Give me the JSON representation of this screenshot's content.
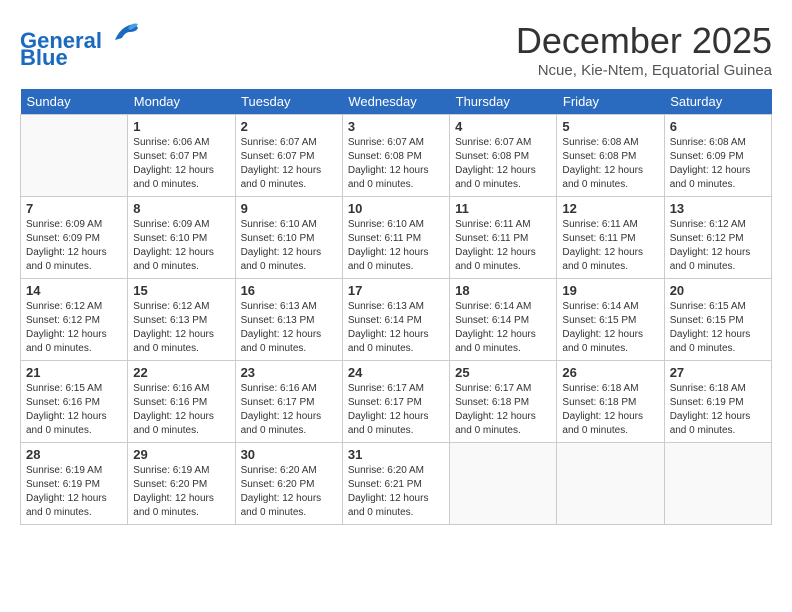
{
  "logo": {
    "line1": "General",
    "line2": "Blue"
  },
  "title": "December 2025",
  "subtitle": "Ncue, Kie-Ntem, Equatorial Guinea",
  "days_of_week": [
    "Sunday",
    "Monday",
    "Tuesday",
    "Wednesday",
    "Thursday",
    "Friday",
    "Saturday"
  ],
  "weeks": [
    [
      {
        "day": null,
        "info": null
      },
      {
        "day": "1",
        "sunrise": "Sunrise: 6:06 AM",
        "sunset": "Sunset: 6:07 PM",
        "daylight": "Daylight: 12 hours and 0 minutes."
      },
      {
        "day": "2",
        "sunrise": "Sunrise: 6:07 AM",
        "sunset": "Sunset: 6:07 PM",
        "daylight": "Daylight: 12 hours and 0 minutes."
      },
      {
        "day": "3",
        "sunrise": "Sunrise: 6:07 AM",
        "sunset": "Sunset: 6:08 PM",
        "daylight": "Daylight: 12 hours and 0 minutes."
      },
      {
        "day": "4",
        "sunrise": "Sunrise: 6:07 AM",
        "sunset": "Sunset: 6:08 PM",
        "daylight": "Daylight: 12 hours and 0 minutes."
      },
      {
        "day": "5",
        "sunrise": "Sunrise: 6:08 AM",
        "sunset": "Sunset: 6:08 PM",
        "daylight": "Daylight: 12 hours and 0 minutes."
      },
      {
        "day": "6",
        "sunrise": "Sunrise: 6:08 AM",
        "sunset": "Sunset: 6:09 PM",
        "daylight": "Daylight: 12 hours and 0 minutes."
      }
    ],
    [
      {
        "day": "7",
        "sunrise": "Sunrise: 6:09 AM",
        "sunset": "Sunset: 6:09 PM",
        "daylight": "Daylight: 12 hours and 0 minutes."
      },
      {
        "day": "8",
        "sunrise": "Sunrise: 6:09 AM",
        "sunset": "Sunset: 6:10 PM",
        "daylight": "Daylight: 12 hours and 0 minutes."
      },
      {
        "day": "9",
        "sunrise": "Sunrise: 6:10 AM",
        "sunset": "Sunset: 6:10 PM",
        "daylight": "Daylight: 12 hours and 0 minutes."
      },
      {
        "day": "10",
        "sunrise": "Sunrise: 6:10 AM",
        "sunset": "Sunset: 6:11 PM",
        "daylight": "Daylight: 12 hours and 0 minutes."
      },
      {
        "day": "11",
        "sunrise": "Sunrise: 6:11 AM",
        "sunset": "Sunset: 6:11 PM",
        "daylight": "Daylight: 12 hours and 0 minutes."
      },
      {
        "day": "12",
        "sunrise": "Sunrise: 6:11 AM",
        "sunset": "Sunset: 6:11 PM",
        "daylight": "Daylight: 12 hours and 0 minutes."
      },
      {
        "day": "13",
        "sunrise": "Sunrise: 6:12 AM",
        "sunset": "Sunset: 6:12 PM",
        "daylight": "Daylight: 12 hours and 0 minutes."
      }
    ],
    [
      {
        "day": "14",
        "sunrise": "Sunrise: 6:12 AM",
        "sunset": "Sunset: 6:12 PM",
        "daylight": "Daylight: 12 hours and 0 minutes."
      },
      {
        "day": "15",
        "sunrise": "Sunrise: 6:12 AM",
        "sunset": "Sunset: 6:13 PM",
        "daylight": "Daylight: 12 hours and 0 minutes."
      },
      {
        "day": "16",
        "sunrise": "Sunrise: 6:13 AM",
        "sunset": "Sunset: 6:13 PM",
        "daylight": "Daylight: 12 hours and 0 minutes."
      },
      {
        "day": "17",
        "sunrise": "Sunrise: 6:13 AM",
        "sunset": "Sunset: 6:14 PM",
        "daylight": "Daylight: 12 hours and 0 minutes."
      },
      {
        "day": "18",
        "sunrise": "Sunrise: 6:14 AM",
        "sunset": "Sunset: 6:14 PM",
        "daylight": "Daylight: 12 hours and 0 minutes."
      },
      {
        "day": "19",
        "sunrise": "Sunrise: 6:14 AM",
        "sunset": "Sunset: 6:15 PM",
        "daylight": "Daylight: 12 hours and 0 minutes."
      },
      {
        "day": "20",
        "sunrise": "Sunrise: 6:15 AM",
        "sunset": "Sunset: 6:15 PM",
        "daylight": "Daylight: 12 hours and 0 minutes."
      }
    ],
    [
      {
        "day": "21",
        "sunrise": "Sunrise: 6:15 AM",
        "sunset": "Sunset: 6:16 PM",
        "daylight": "Daylight: 12 hours and 0 minutes."
      },
      {
        "day": "22",
        "sunrise": "Sunrise: 6:16 AM",
        "sunset": "Sunset: 6:16 PM",
        "daylight": "Daylight: 12 hours and 0 minutes."
      },
      {
        "day": "23",
        "sunrise": "Sunrise: 6:16 AM",
        "sunset": "Sunset: 6:17 PM",
        "daylight": "Daylight: 12 hours and 0 minutes."
      },
      {
        "day": "24",
        "sunrise": "Sunrise: 6:17 AM",
        "sunset": "Sunset: 6:17 PM",
        "daylight": "Daylight: 12 hours and 0 minutes."
      },
      {
        "day": "25",
        "sunrise": "Sunrise: 6:17 AM",
        "sunset": "Sunset: 6:18 PM",
        "daylight": "Daylight: 12 hours and 0 minutes."
      },
      {
        "day": "26",
        "sunrise": "Sunrise: 6:18 AM",
        "sunset": "Sunset: 6:18 PM",
        "daylight": "Daylight: 12 hours and 0 minutes."
      },
      {
        "day": "27",
        "sunrise": "Sunrise: 6:18 AM",
        "sunset": "Sunset: 6:19 PM",
        "daylight": "Daylight: 12 hours and 0 minutes."
      }
    ],
    [
      {
        "day": "28",
        "sunrise": "Sunrise: 6:19 AM",
        "sunset": "Sunset: 6:19 PM",
        "daylight": "Daylight: 12 hours and 0 minutes."
      },
      {
        "day": "29",
        "sunrise": "Sunrise: 6:19 AM",
        "sunset": "Sunset: 6:20 PM",
        "daylight": "Daylight: 12 hours and 0 minutes."
      },
      {
        "day": "30",
        "sunrise": "Sunrise: 6:20 AM",
        "sunset": "Sunset: 6:20 PM",
        "daylight": "Daylight: 12 hours and 0 minutes."
      },
      {
        "day": "31",
        "sunrise": "Sunrise: 6:20 AM",
        "sunset": "Sunset: 6:21 PM",
        "daylight": "Daylight: 12 hours and 0 minutes."
      },
      {
        "day": null,
        "info": null
      },
      {
        "day": null,
        "info": null
      },
      {
        "day": null,
        "info": null
      }
    ]
  ]
}
